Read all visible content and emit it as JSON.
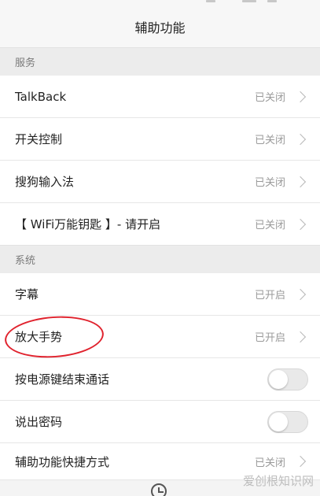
{
  "header": {
    "title": "辅助功能"
  },
  "sections": [
    {
      "title": "服务",
      "items": [
        {
          "label": "TalkBack",
          "status": "已关闭"
        },
        {
          "label": "开关控制",
          "status": "已关闭"
        },
        {
          "label": "搜狗输入法",
          "status": "已关闭"
        },
        {
          "label": "【 WiFi万能钥匙 】- 请开启",
          "status": "已关闭"
        }
      ]
    },
    {
      "title": "系统",
      "items": [
        {
          "label": "字幕",
          "status": "已开启"
        },
        {
          "label": "放大手势",
          "status": "已开启"
        },
        {
          "label": "按电源键结束通话",
          "toggle": false
        },
        {
          "label": "说出密码",
          "toggle": false
        },
        {
          "label": "辅助功能快捷方式",
          "status": "已关闭"
        }
      ]
    }
  ],
  "watermark": {
    "text": "爱创根知识网"
  },
  "colors": {
    "annotation": "#e0222d",
    "background": "#f2f2f2"
  }
}
